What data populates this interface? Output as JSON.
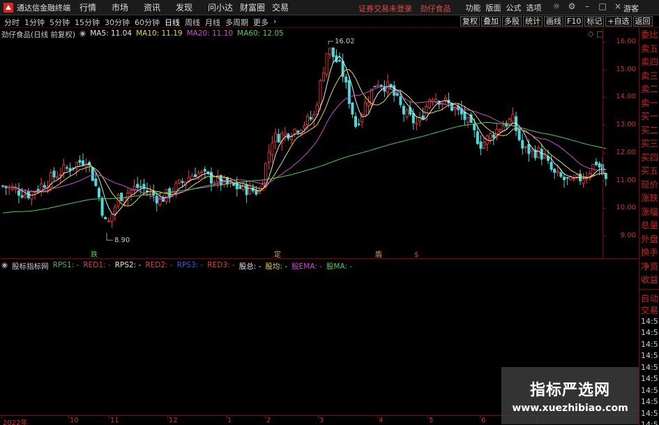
{
  "app": {
    "title": "通达信金融终端",
    "menus": [
      "行情",
      "市场",
      "资讯",
      "发现",
      "问小达",
      "财富圈",
      "交易"
    ],
    "center_message": [
      "证券交易未登录",
      "劲仔食品"
    ],
    "right_menus": [
      "功能",
      "版面",
      "公式",
      "选项"
    ],
    "user": "游客",
    "icons": [
      "bulb-icon",
      "settings-icon",
      "minimize-icon",
      "maximize-icon",
      "close-icon"
    ]
  },
  "periods": {
    "items": [
      "分时",
      "1分钟",
      "5分钟",
      "15分钟",
      "30分钟",
      "60分钟",
      "日线",
      "周线",
      "月线",
      "多周期",
      "更多"
    ],
    "active": "日线"
  },
  "tools": [
    "复权",
    "叠加",
    "多股",
    "统计",
    "画线",
    "F10",
    "标记",
    "+自选",
    "返回"
  ],
  "chart_header": {
    "stock": "劲仔食品(日线 前复权)",
    "ma_labels": [
      {
        "text": "MA5: 11.04",
        "color": "#e8e8e8"
      },
      {
        "text": "MA10: 11.19",
        "color": "#e8d84a"
      },
      {
        "text": "MA20: 11.10",
        "color": "#d04ad0"
      },
      {
        "text": "MA60: 12.05",
        "color": "#4ad04a"
      }
    ]
  },
  "price_axis": [
    "16.00",
    "15.00",
    "14.00",
    "13.00",
    "12.00",
    "11.00",
    "10.00",
    "9.00"
  ],
  "chart_data": {
    "type": "candlestick",
    "ylim": [
      8.5,
      16.3
    ],
    "annotations": [
      {
        "text": "16.02",
        "kind": "high"
      },
      {
        "text": "8.90",
        "kind": "low"
      }
    ],
    "markers": [
      {
        "text": "跌",
        "color": "#4ad04a"
      },
      {
        "text": "定",
        "color": "#e8a040"
      },
      {
        "text": "盾",
        "color": "#e8a040"
      },
      {
        "text": "$",
        "color": "#e04040"
      }
    ],
    "ma_series": [
      {
        "name": "MA5",
        "color": "#e8e8e8"
      },
      {
        "name": "MA10",
        "color": "#e8d84a"
      },
      {
        "name": "MA20",
        "color": "#d04ad0"
      },
      {
        "name": "MA60",
        "color": "#4ad04a"
      }
    ],
    "date_ticks": [
      "2022年",
      "10",
      "11",
      "12",
      "1",
      "2",
      "3",
      "4",
      "5",
      "6",
      "7"
    ]
  },
  "indicator_header": {
    "name": "股标指标网",
    "items": [
      {
        "text": "RPS1: -",
        "color": "#4ab04a"
      },
      {
        "text": "RED1: -",
        "color": "#e04040"
      },
      {
        "text": "RPS2: -",
        "color": "#e8e8c0"
      },
      {
        "text": "RED2: -",
        "color": "#e04040"
      },
      {
        "text": "RPS3: -",
        "color": "#3060e0"
      },
      {
        "text": "RED3: -",
        "color": "#e04040"
      },
      {
        "text": "股总: -",
        "color": "#e8e8e8"
      },
      {
        "text": "股均: -",
        "color": "#e8d84a"
      },
      {
        "text": "股EMA: -",
        "color": "#d04ad0"
      },
      {
        "text": "股MA: -",
        "color": "#4ad04a"
      }
    ]
  },
  "quote_panel": {
    "labels": [
      "委比",
      "卖五",
      "卖四",
      "卖三",
      "卖二",
      "卖一",
      "买一",
      "买二",
      "买三",
      "买四",
      "买五",
      "现价",
      "涨跌",
      "涨幅",
      "总量",
      "外盘",
      "换手",
      "净资",
      "收益"
    ],
    "trade_labels": [
      "自动",
      "交易"
    ],
    "times": [
      "14:5",
      "14:5",
      "14:5",
      "14:5",
      "14:5",
      "14:5",
      "14:5",
      "14:5",
      "14:5",
      "14:5",
      "14:5"
    ]
  },
  "watermark": {
    "title": "指标严选网",
    "url": "www.xuezhibiao.com"
  }
}
